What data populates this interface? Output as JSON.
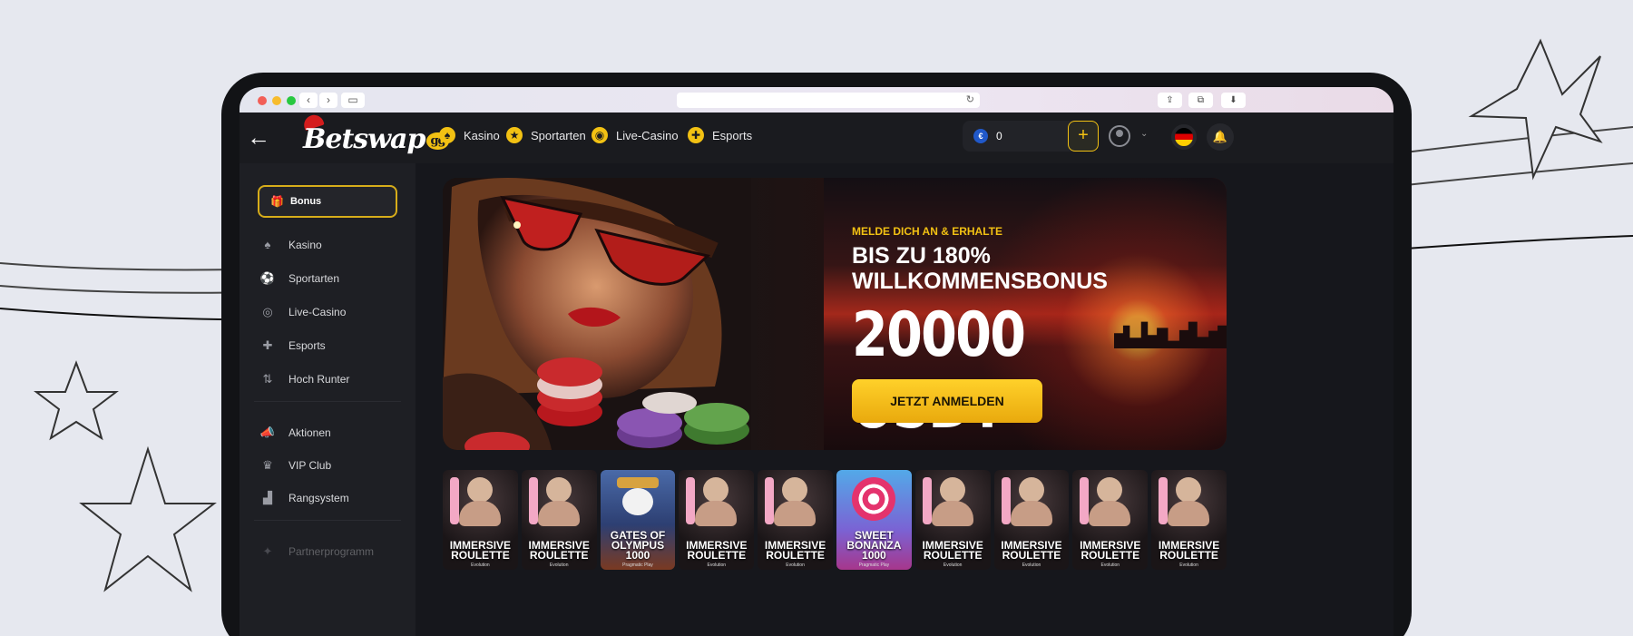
{
  "nav": {
    "items": [
      {
        "label": "Kasino",
        "icon": "spade-icon"
      },
      {
        "label": "Sportarten",
        "icon": "soccer-ball-icon"
      },
      {
        "label": "Live-Casino",
        "icon": "live-casino-icon"
      },
      {
        "label": "Esports",
        "icon": "gamepad-icon"
      }
    ],
    "logo_text": "Betswap",
    "logo_suffix": "gg",
    "wallet_balance": "0"
  },
  "sidebar": {
    "bonus_label": "Bonus",
    "items": [
      {
        "label": "Kasino",
        "icon": "spade-icon"
      },
      {
        "label": "Sportarten",
        "icon": "soccer-ball-icon"
      },
      {
        "label": "Live-Casino",
        "icon": "live-casino-icon"
      },
      {
        "label": "Esports",
        "icon": "gamepad-icon"
      },
      {
        "label": "Hoch Runter",
        "icon": "up-down-arrows-icon"
      },
      {
        "label": "Aktionen",
        "icon": "megaphone-icon"
      },
      {
        "label": "VIP Club",
        "icon": "crown-icon"
      },
      {
        "label": "Rangsystem",
        "icon": "podium-icon"
      },
      {
        "label": "Partnerprogramm",
        "icon": "partner-icon"
      }
    ]
  },
  "hero": {
    "subtitle": "MELDE DICH AN & ERHALTE",
    "headline": "BIS ZU 180% WILLKOMMENSBONUS",
    "amount": "20000 USDT",
    "cta_label": "JETZT ANMELDEN"
  },
  "games": [
    {
      "title": "IMMERSIVE ROULETTE",
      "studio": "Evolution"
    },
    {
      "title": "IMMERSIVE ROULETTE",
      "studio": "Evolution"
    },
    {
      "title": "GATES OF OLYMPUS 1000",
      "studio": "Pragmatic Play"
    },
    {
      "title": "IMMERSIVE ROULETTE",
      "studio": "Evolution"
    },
    {
      "title": "IMMERSIVE ROULETTE",
      "studio": "Evolution"
    },
    {
      "title": "SWEET BONANZA 1000",
      "studio": "Pragmatic Play"
    },
    {
      "title": "IMMERSIVE ROULETTE",
      "studio": "Evolution"
    },
    {
      "title": "IMMERSIVE ROULETTE",
      "studio": "Evolution"
    },
    {
      "title": "IMMERSIVE ROULETTE",
      "studio": "Evolution"
    },
    {
      "title": "IMMERSIVE ROULETTE",
      "studio": "Evolution"
    }
  ],
  "colors": {
    "accent": "#f2c113",
    "background": "#16171c",
    "sidebar": "#1e1f24",
    "page_background": "#e6e8ef"
  }
}
